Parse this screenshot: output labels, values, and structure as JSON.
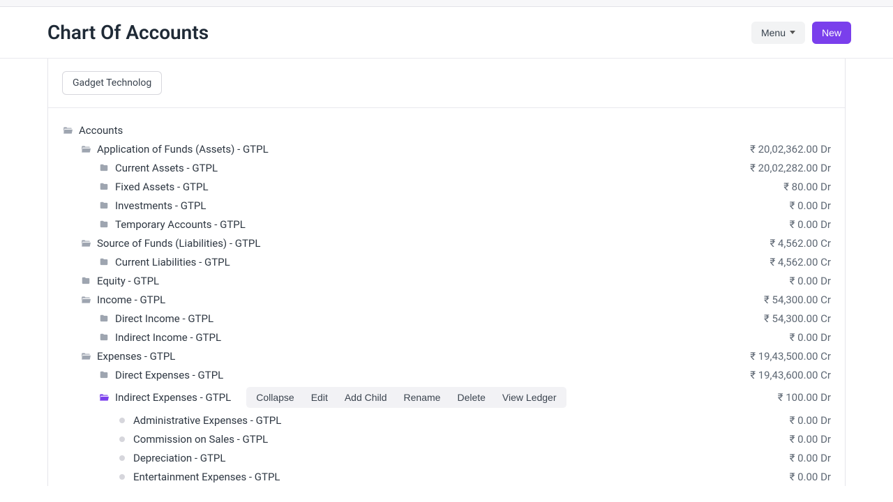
{
  "header": {
    "title": "Chart Of Accounts",
    "menu_label": "Menu",
    "new_label": "New"
  },
  "company": "Gadget Technolog",
  "root_label": "Accounts",
  "toolbar": {
    "collapse": "Collapse",
    "edit": "Edit",
    "add_child": "Add Child",
    "rename": "Rename",
    "delete": "Delete",
    "view_ledger": "View Ledger"
  },
  "nodes": [
    {
      "id": "n1",
      "indent": 1,
      "icon": "folder-open",
      "label": "Application of Funds (Assets) - GTPL",
      "balance": "₹ 20,02,362.00 Dr"
    },
    {
      "id": "n2",
      "indent": 2,
      "icon": "folder",
      "label": "Current Assets - GTPL",
      "balance": "₹ 20,02,282.00 Dr"
    },
    {
      "id": "n3",
      "indent": 2,
      "icon": "folder",
      "label": "Fixed Assets - GTPL",
      "balance": "₹ 80.00 Dr"
    },
    {
      "id": "n4",
      "indent": 2,
      "icon": "folder",
      "label": "Investments - GTPL",
      "balance": "₹ 0.00 Dr"
    },
    {
      "id": "n5",
      "indent": 2,
      "icon": "folder",
      "label": "Temporary Accounts - GTPL",
      "balance": "₹ 0.00 Dr"
    },
    {
      "id": "n6",
      "indent": 1,
      "icon": "folder-open",
      "label": "Source of Funds (Liabilities) - GTPL",
      "balance": "₹ 4,562.00 Cr"
    },
    {
      "id": "n7",
      "indent": 2,
      "icon": "folder",
      "label": "Current Liabilities - GTPL",
      "balance": "₹ 4,562.00 Cr"
    },
    {
      "id": "n8",
      "indent": 1,
      "icon": "folder",
      "label": "Equity - GTPL",
      "balance": "₹ 0.00 Dr"
    },
    {
      "id": "n9",
      "indent": 1,
      "icon": "folder-open",
      "label": "Income - GTPL",
      "balance": "₹ 54,300.00 Cr"
    },
    {
      "id": "n10",
      "indent": 2,
      "icon": "folder",
      "label": "Direct Income - GTPL",
      "balance": "₹ 54,300.00 Cr"
    },
    {
      "id": "n11",
      "indent": 2,
      "icon": "folder",
      "label": "Indirect Income - GTPL",
      "balance": "₹ 0.00 Dr"
    },
    {
      "id": "n12",
      "indent": 1,
      "icon": "folder-open",
      "label": "Expenses - GTPL",
      "balance": "₹ 19,43,500.00 Cr"
    },
    {
      "id": "n13",
      "indent": 2,
      "icon": "folder",
      "label": "Direct Expenses - GTPL",
      "balance": "₹ 19,43,600.00 Cr"
    },
    {
      "id": "n14",
      "indent": 2,
      "icon": "folder-open",
      "selected": true,
      "label": "Indirect Expenses - GTPL",
      "balance": "₹ 100.00 Dr",
      "toolbar": true
    },
    {
      "id": "n15",
      "indent": 3,
      "icon": "dot",
      "label": "Administrative Expenses - GTPL",
      "balance": "₹ 0.00 Dr"
    },
    {
      "id": "n16",
      "indent": 3,
      "icon": "dot",
      "label": "Commission on Sales - GTPL",
      "balance": "₹ 0.00 Dr"
    },
    {
      "id": "n17",
      "indent": 3,
      "icon": "dot",
      "label": "Depreciation - GTPL",
      "balance": "₹ 0.00 Dr"
    },
    {
      "id": "n18",
      "indent": 3,
      "icon": "dot",
      "label": "Entertainment Expenses - GTPL",
      "balance": "₹ 0.00 Dr"
    }
  ]
}
